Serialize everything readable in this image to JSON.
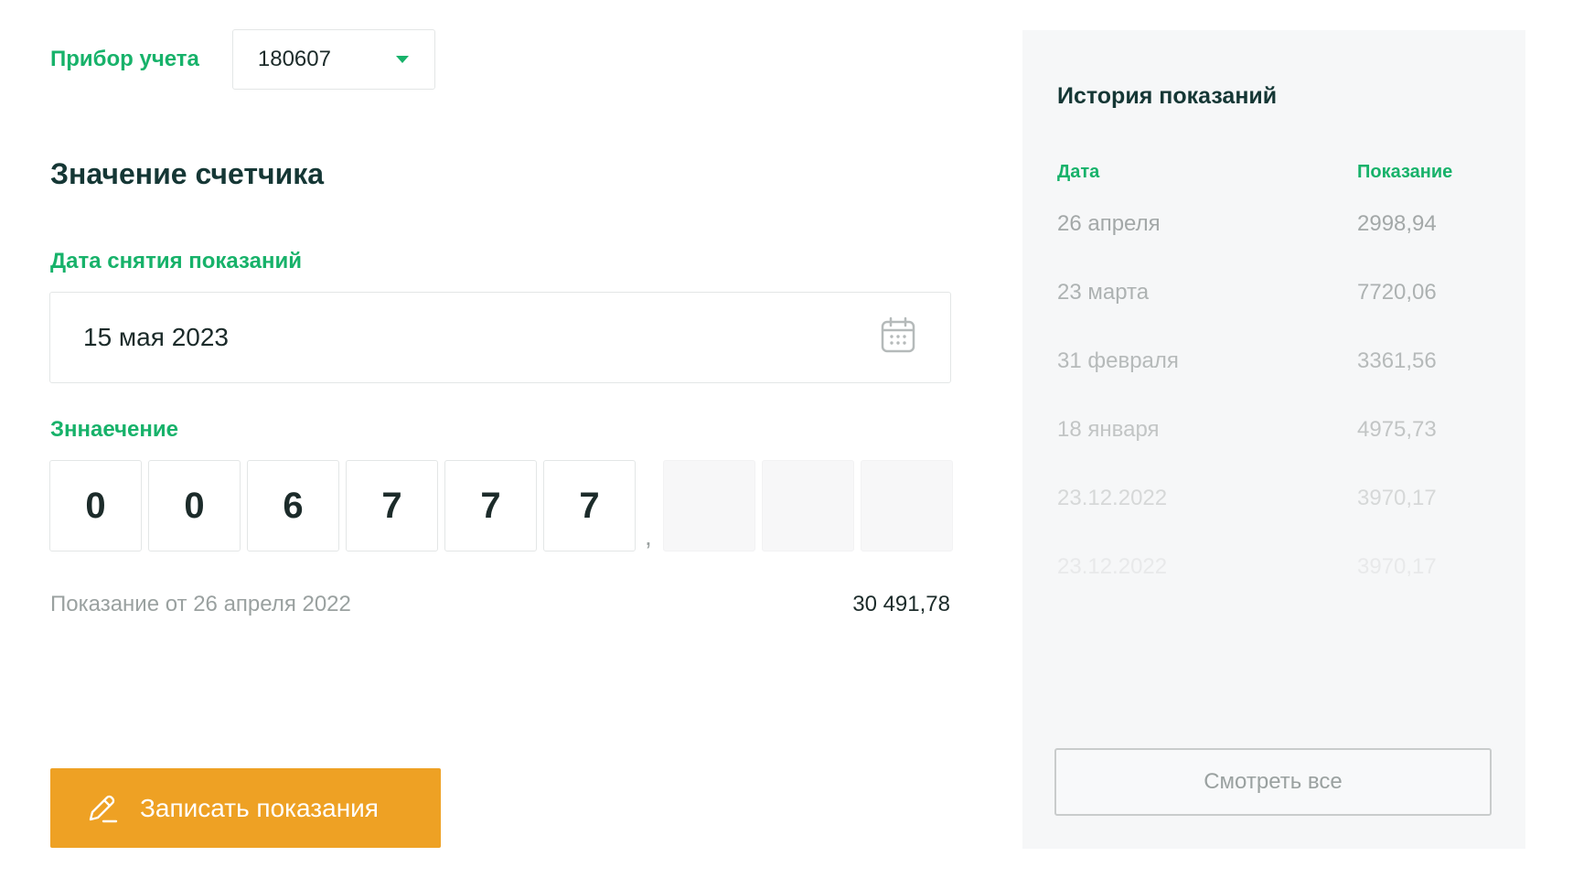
{
  "meter": {
    "label": "Прибор учета",
    "selected": "180607"
  },
  "form": {
    "title": "Значение счетчика",
    "date_label": "Дата снятия показаний",
    "date_value": "15 мая 2023",
    "value_label": "Зннаечение",
    "digits": [
      "0",
      "0",
      "6",
      "7",
      "7",
      "7"
    ],
    "fraction_digits": [
      "",
      "",
      ""
    ],
    "decimal_separator": ",",
    "previous_reading_label": "Показание от 26 апреля 2022",
    "previous_reading_value": "30 491,78",
    "submit_label": "Записать показания"
  },
  "history": {
    "title": "История показаний",
    "col_date": "Дата",
    "col_value": "Показание",
    "rows": [
      {
        "date": "26 апреля",
        "value": "2998,94"
      },
      {
        "date": "23 марта",
        "value": "7720,06"
      },
      {
        "date": "31 февраля",
        "value": "3361,56"
      },
      {
        "date": "18 января",
        "value": "4975,73"
      },
      {
        "date": "23.12.2022",
        "value": "3970,17"
      },
      {
        "date": "23.12.2022",
        "value": "3970,17"
      }
    ],
    "view_all_label": "Смотреть все"
  },
  "colors": {
    "accent_green": "#17b26a",
    "button_orange": "#eea124",
    "heading_dark": "#153735",
    "panel_bg": "#f6f7f8"
  }
}
